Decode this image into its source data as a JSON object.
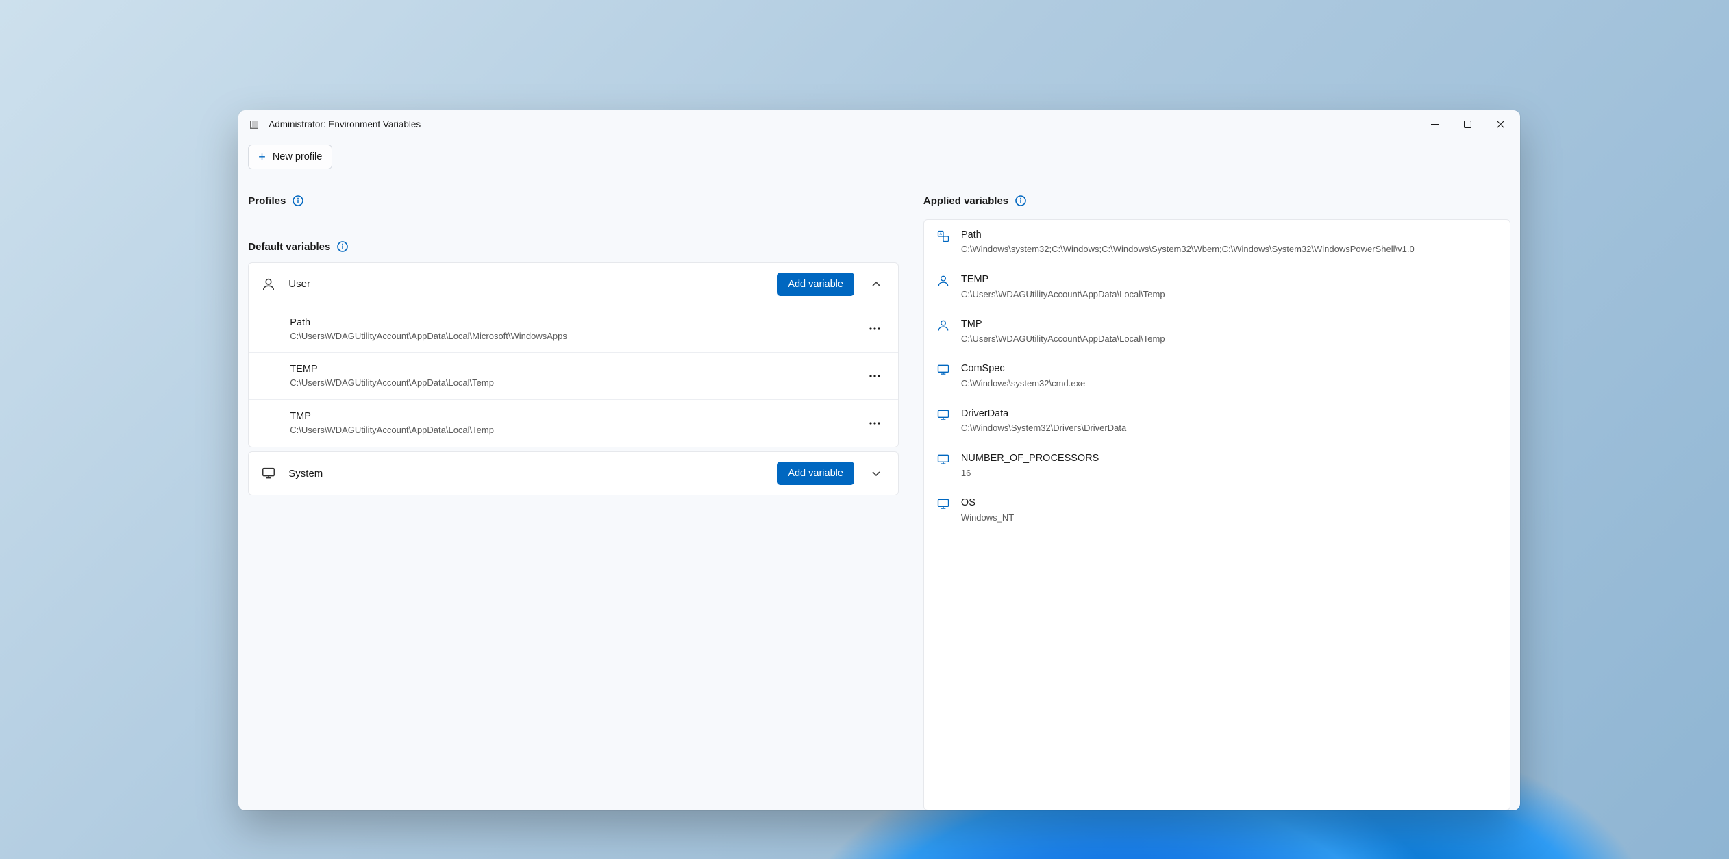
{
  "window": {
    "title": "Administrator: Environment Variables"
  },
  "toolbar": {
    "new_profile": "New profile"
  },
  "sections": {
    "profiles_heading": "Profiles",
    "default_vars_heading": "Default variables",
    "applied_heading": "Applied variables"
  },
  "scopes": {
    "user": {
      "label": "User",
      "add_btn": "Add variable",
      "vars": [
        {
          "name": "Path",
          "value": "C:\\Users\\WDAGUtilityAccount\\AppData\\Local\\Microsoft\\WindowsApps"
        },
        {
          "name": "TEMP",
          "value": "C:\\Users\\WDAGUtilityAccount\\AppData\\Local\\Temp"
        },
        {
          "name": "TMP",
          "value": "C:\\Users\\WDAGUtilityAccount\\AppData\\Local\\Temp"
        }
      ]
    },
    "system": {
      "label": "System",
      "add_btn": "Add variable"
    }
  },
  "applied": [
    {
      "icon": "merge",
      "name": "Path",
      "value": "C:\\Windows\\system32;C:\\Windows;C:\\Windows\\System32\\Wbem;C:\\Windows\\System32\\WindowsPowerShell\\v1.0"
    },
    {
      "icon": "user",
      "name": "TEMP",
      "value": "C:\\Users\\WDAGUtilityAccount\\AppData\\Local\\Temp"
    },
    {
      "icon": "user",
      "name": "TMP",
      "value": "C:\\Users\\WDAGUtilityAccount\\AppData\\Local\\Temp"
    },
    {
      "icon": "system",
      "name": "ComSpec",
      "value": "C:\\Windows\\system32\\cmd.exe"
    },
    {
      "icon": "system",
      "name": "DriverData",
      "value": "C:\\Windows\\System32\\Drivers\\DriverData"
    },
    {
      "icon": "system",
      "name": "NUMBER_OF_PROCESSORS",
      "value": "16"
    },
    {
      "icon": "system",
      "name": "OS",
      "value": "Windows_NT"
    }
  ]
}
